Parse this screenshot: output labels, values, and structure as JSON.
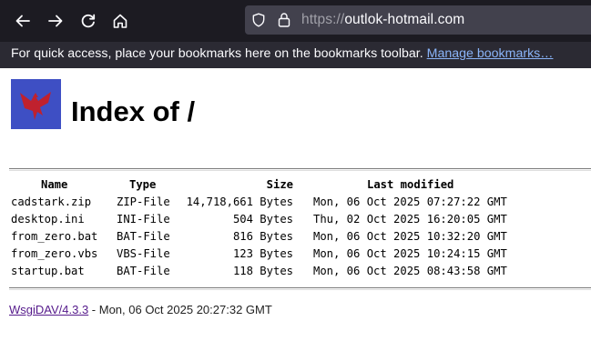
{
  "browser": {
    "url_scheme": "https://",
    "url_host": "outlok-hotmail.com",
    "bookmarks_message": "For quick access, place your bookmarks here on the bookmarks toolbar.",
    "manage_bookmarks_label": "Manage bookmarks…",
    "icons": [
      "back-arrow-icon",
      "forward-arrow-icon",
      "reload-icon",
      "home-icon",
      "shield-icon",
      "lock-icon"
    ]
  },
  "page": {
    "title": "Index of /",
    "logo_colors": {
      "background": "#3e4fc4",
      "bird": "#c0212e"
    },
    "listing": {
      "headers": {
        "name": "Name",
        "type": "Type",
        "size": "Size",
        "modified": "Last modified"
      },
      "rows": [
        {
          "name": "cadstark.zip",
          "type": "ZIP-File",
          "size": "14,718,661 Bytes",
          "modified": "Mon, 06 Oct 2025 07:27:22 GMT"
        },
        {
          "name": "desktop.ini",
          "type": "INI-File",
          "size": "504 Bytes",
          "modified": "Thu, 02 Oct 2025 16:20:05 GMT"
        },
        {
          "name": "from_zero.bat",
          "type": "BAT-File",
          "size": "816 Bytes",
          "modified": "Mon, 06 Oct 2025 10:32:20 GMT"
        },
        {
          "name": "from_zero.vbs",
          "type": "VBS-File",
          "size": "123 Bytes",
          "modified": "Mon, 06 Oct 2025 10:24:15 GMT"
        },
        {
          "name": "startup.bat",
          "type": "BAT-File",
          "size": "118 Bytes",
          "modified": "Mon, 06 Oct 2025 08:43:58 GMT"
        }
      ]
    },
    "footer": {
      "server_link": "WsgiDAV/4.3.3",
      "timestamp": " - Mon, 06 Oct 2025 20:27:32 GMT"
    }
  }
}
